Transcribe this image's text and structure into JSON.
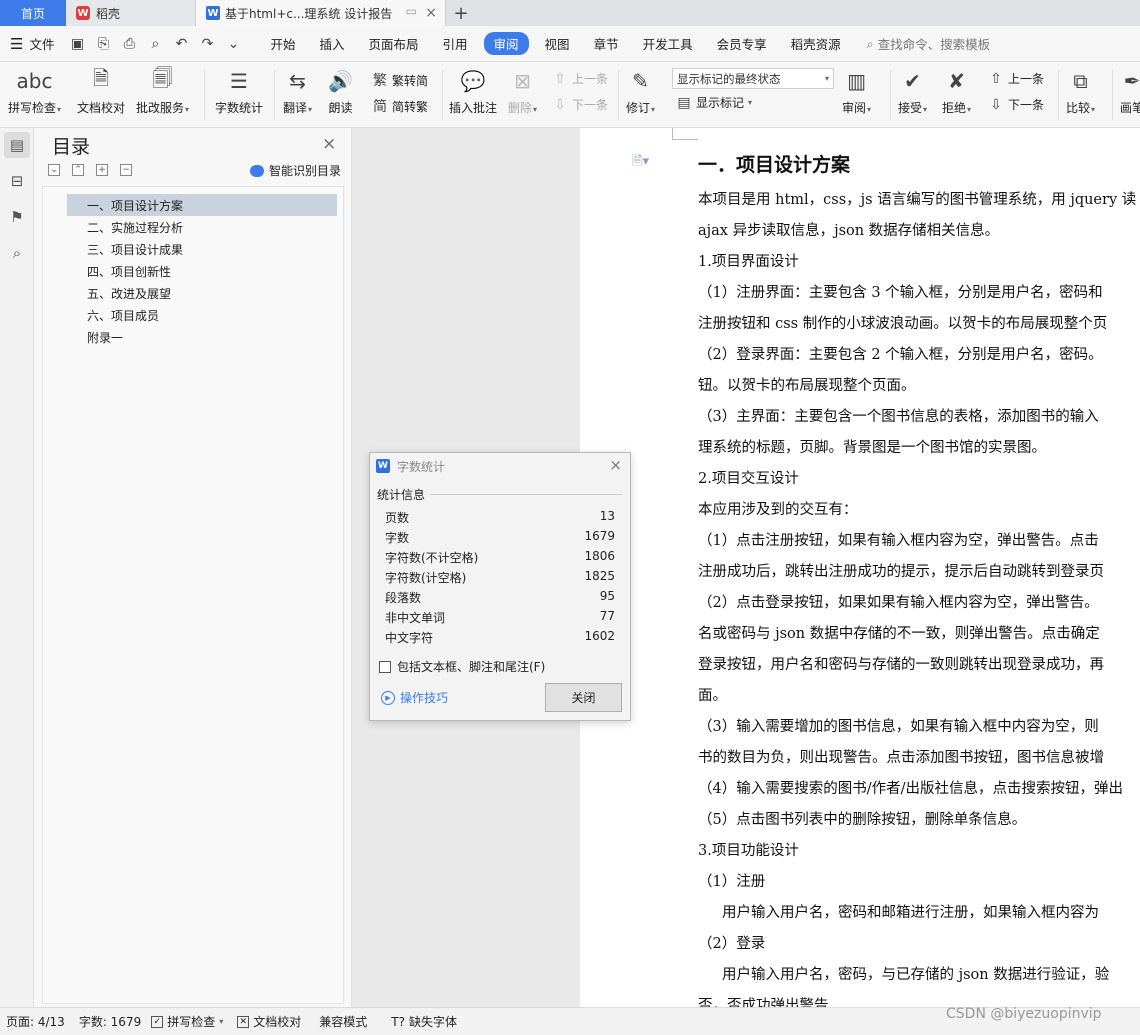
{
  "tabs": {
    "home": "首页",
    "daoke": "稻壳",
    "doc": "基于html+c...理系统 设计报告",
    "new": "+"
  },
  "menu": {
    "file": "文件",
    "tabs": [
      "开始",
      "插入",
      "页面布局",
      "引用",
      "审阅",
      "视图",
      "章节",
      "开发工具",
      "会员专享",
      "稻壳资源"
    ],
    "active": "审阅",
    "search": "查找命令、搜索模板"
  },
  "ribbon": {
    "spell": "拼写检查",
    "proof": "文档校对",
    "batch": "批改服务",
    "wordcount": "字数统计",
    "translate": "翻译",
    "read": "朗读",
    "trad": "繁转简",
    "simp": "简转繁",
    "insert_comment": "插入批注",
    "delete": "删除",
    "prev_comment": "上一条",
    "next_comment": "下一条",
    "revise": "修订",
    "markup_mode": "显示标记的最终状态",
    "show_markup": "显示标记",
    "review": "审阅",
    "accept": "接受",
    "reject": "拒绝",
    "prev": "上一条",
    "next": "下一条",
    "compare": "比较",
    "ink": "画笔"
  },
  "toc": {
    "title": "目录",
    "smart": "智能识别目录",
    "items": [
      "一、项目设计方案",
      "二、实施过程分析",
      "三、项目设计成果",
      "四、项目创新性",
      "五、改进及展望",
      "六、项目成员",
      "附录一"
    ]
  },
  "document": {
    "heading": "一．项目设计方案",
    "lines": [
      "本项目是用 html，css，js 语言编写的图书管理系统，用 jquery 读",
      "ajax 异步读取信息，json 数据存储相关信息。",
      "1.项目界面设计",
      "（1）注册界面：主要包含 3 个输入框，分别是用户名，密码和",
      "注册按钮和 css 制作的小球波浪动画。以贺卡的布局展现整个页",
      "（2）登录界面：主要包含 2 个输入框，分别是用户名，密码。",
      "钮。以贺卡的布局展现整个页面。",
      "（3）主界面：主要包含一个图书信息的表格，添加图书的输入",
      "理系统的标题，页脚。背景图是一个图书馆的实景图。",
      "2.项目交互设计",
      "本应用涉及到的交互有：",
      "（1）点击注册按钮，如果有输入框内容为空，弹出警告。点击",
      "注册成功后，跳转出注册成功的提示，提示后自动跳转到登录页",
      "（2）点击登录按钮，如果如果有输入框内容为空，弹出警告。",
      "名或密码与 json 数据中存储的不一致，则弹出警告。点击确定",
      "登录按钮，用户名和密码与存储的一致则跳转出现登录成功，再",
      "面。",
      "（3）输入需要增加的图书信息，如果有输入框中内容为空，则",
      "书的数目为负，则出现警告。点击添加图书按钮，图书信息被增",
      "（4）输入需要搜索的图书/作者/出版社信息，点击搜索按钮，弹出",
      "（5）点击图书列表中的删除按钮，删除单条信息。",
      "3.项目功能设计",
      "（1）注册",
      "用户输入用户名，密码和邮箱进行注册，如果输入框内容为",
      "（2）登录",
      "用户输入用户名，密码，与已存储的 json 数据进行验证，验",
      "否，否成功弹出警告"
    ]
  },
  "dialog": {
    "title": "字数统计",
    "section": "统计信息",
    "stats": [
      {
        "label": "页数",
        "value": "13"
      },
      {
        "label": "字数",
        "value": "1679"
      },
      {
        "label": "字符数(不计空格)",
        "value": "1806"
      },
      {
        "label": "字符数(计空格)",
        "value": "1825"
      },
      {
        "label": "段落数",
        "value": "95"
      },
      {
        "label": "非中文单词",
        "value": "77"
      },
      {
        "label": "中文字符",
        "value": "1602"
      }
    ],
    "checkbox": "包括文本框、脚注和尾注(F)",
    "tips": "操作技巧",
    "close": "关闭"
  },
  "status": {
    "page": "页面: 4/13",
    "words": "字数: 1679",
    "spell": "拼写检查",
    "proof": "文档校对",
    "compat": "兼容模式",
    "missing_font": "缺失字体"
  },
  "watermark": "CSDN @biyezuopinvip"
}
